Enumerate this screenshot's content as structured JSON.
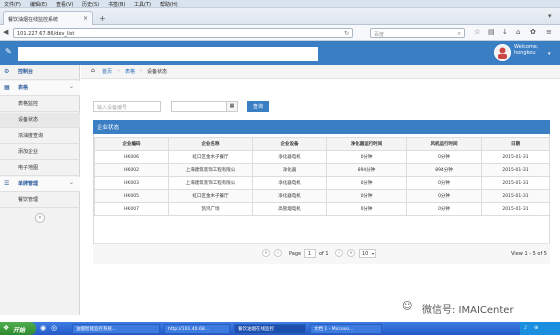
{
  "browser": {
    "menu": [
      "文件(F)",
      "编辑(E)",
      "查看(V)",
      "历史(S)",
      "书签(B)",
      "工具(T)",
      "帮助(H)"
    ],
    "tab_title": "餐饮油烟在线监控系统",
    "url": "101.227.67.86/dev_list",
    "search_placeholder": "百度"
  },
  "header": {
    "welcome_line1": "Welcome,",
    "welcome_line2": "hongkou"
  },
  "sidebar": {
    "items": [
      {
        "label": "控制台",
        "head": true
      },
      {
        "label": "表格",
        "head": true
      },
      {
        "label": "表格监控"
      },
      {
        "label": "设备状态"
      },
      {
        "label": "浓油度查询"
      },
      {
        "label": "添加企业"
      },
      {
        "label": "电子地图"
      },
      {
        "label": "单牌管理",
        "head": true
      },
      {
        "label": "餐饮管理"
      }
    ]
  },
  "breadcrumb": [
    "首页",
    "表格",
    "设备状态"
  ],
  "search": {
    "placeholder": "输入设备编号",
    "date_value": "",
    "button": "查询"
  },
  "panel_title": "企业状态",
  "table": {
    "columns": [
      "企业编码",
      "企业名称",
      "企业设备",
      "净化器运行时间",
      "风机运行时间",
      "日期"
    ],
    "rows": [
      [
        "HK006",
        "虹口区金木子餐厅",
        "净化器电机",
        "0分钟",
        "0分钟",
        "2015-01-31"
      ],
      [
        "HK002",
        "上海建筑装饰工程有限公",
        "净化器",
        "894分钟",
        "894分钟",
        "2015-01-31"
      ],
      [
        "HK003",
        "上海建筑装饰工程有限公",
        "净化器电机",
        "0分钟",
        "0分钟",
        "2015-01-31"
      ],
      [
        "HK005",
        "虹口区金木子餐厅",
        "净化器电机",
        "0分钟",
        "0分钟",
        "2015-01-31"
      ],
      [
        "HK007",
        "凯鸿广场",
        "高管烟电机",
        "0分钟",
        "0分钟",
        "2015-01-31"
      ]
    ]
  },
  "pager": {
    "page_label": "Page",
    "page_value": "1",
    "of_label": "of 1",
    "per_page": "10",
    "summary": "View 1 - 5 of 5"
  },
  "taskbar": {
    "start": "开始",
    "tasks": [
      "油烟智能监控系统...",
      "http://101.40.68...",
      "餐饮油烟在线监控",
      "文档 1 - Microso..."
    ]
  },
  "watermark": "微信号: IMAICenter"
}
